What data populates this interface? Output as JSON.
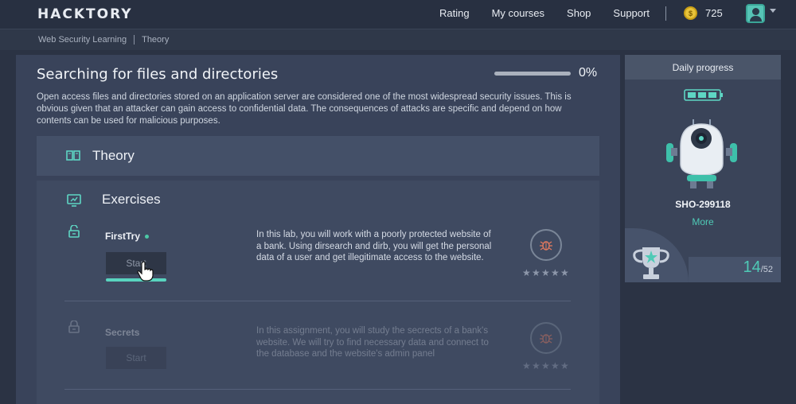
{
  "header": {
    "logo": "HACKTORY",
    "nav": [
      "Rating",
      "My courses",
      "Shop",
      "Support"
    ],
    "coins": "725"
  },
  "breadcrumb": [
    "Web Security Learning",
    "Theory"
  ],
  "main": {
    "title": "Searching for files and directories",
    "progress_percent": 0,
    "progress_label": "0%",
    "description": "Open access files and directories stored on an application server are considered one of the most widespread security issues. This is obvious given that an attacker can gain access to confidential data. The consequences of attacks are specific and depend on how contents can be used for malicious purposes.",
    "theory_label": "Theory",
    "exercises_label": "Exercises",
    "exercises": [
      {
        "name": "FirstTry",
        "start_label": "Start",
        "text": "In this lab, you will work with a poorly protected website of a bank. Using dirsearch and dirb, you will get the personal data of a user and get illegitimate access to the website.",
        "stars_filled": 0
      },
      {
        "name": "Secrets",
        "start_label": "Start",
        "text": "In this assignment, you will study the secrects of a bank's website. We will try to find necessary data and connect to the database and the website's admin panel",
        "stars_filled": 0
      }
    ]
  },
  "daily": {
    "title": "Daily progress",
    "user_id": "SHO-299118",
    "more_label": "More",
    "count": "14",
    "total": "/52"
  },
  "colors": {
    "accent": "#4fcab6",
    "background": "#2b3344"
  }
}
